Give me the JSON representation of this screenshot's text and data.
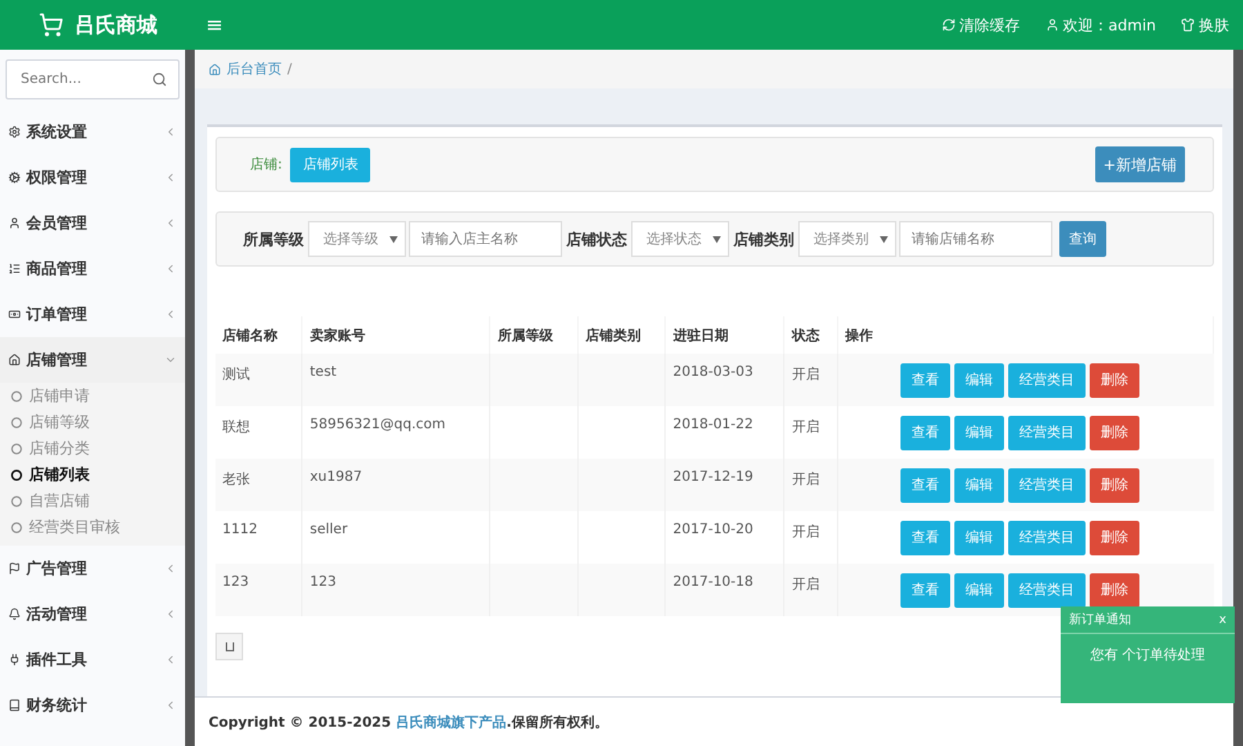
{
  "header": {
    "brand": "吕氏商城",
    "menu_toggle": "≡",
    "actions": [
      {
        "kind": "refresh",
        "label": "清除缓存"
      },
      {
        "kind": "user",
        "label": "欢迎：admin"
      },
      {
        "kind": "skin",
        "label": "换肤"
      }
    ]
  },
  "sidebar": {
    "search": {
      "placeholder": "Search..."
    },
    "items": [
      {
        "kind": "gear",
        "label": "系统设置",
        "expanded": false
      },
      {
        "kind": "gears",
        "label": "权限管理",
        "expanded": false
      },
      {
        "kind": "user",
        "label": "会员管理",
        "expanded": false
      },
      {
        "kind": "list",
        "label": "商品管理",
        "expanded": false
      },
      {
        "kind": "money",
        "label": "订单管理",
        "expanded": false
      },
      {
        "kind": "home",
        "label": "店铺管理",
        "expanded": true,
        "children": [
          {
            "label": "店铺申请",
            "selected": false
          },
          {
            "label": "店铺等级",
            "selected": false
          },
          {
            "label": "店铺分类",
            "selected": false
          },
          {
            "label": "店铺列表",
            "selected": true
          },
          {
            "label": "自营店铺",
            "selected": false
          },
          {
            "label": "经营类目审核",
            "selected": false
          }
        ]
      },
      {
        "kind": "flag",
        "label": "广告管理",
        "expanded": false
      },
      {
        "kind": "bell",
        "label": "活动管理",
        "expanded": false
      },
      {
        "kind": "plug",
        "label": "插件工具",
        "expanded": false
      },
      {
        "kind": "book",
        "label": "财务统计",
        "expanded": false
      }
    ]
  },
  "breadcrumb": {
    "home": "后台首页",
    "separator": "/"
  },
  "toolbar": {
    "label": "店铺:",
    "tab": "店铺列表",
    "add_button": "+新增店铺"
  },
  "filters": [
    {
      "kind": "label",
      "text": "所属等级"
    },
    {
      "kind": "select",
      "text": "选择等级"
    },
    {
      "kind": "input",
      "placeholder": "请输入店主名称"
    },
    {
      "kind": "label",
      "text": "店铺状态"
    },
    {
      "kind": "select",
      "text": "选择状态"
    },
    {
      "kind": "label",
      "text": "店铺类别"
    },
    {
      "kind": "select",
      "text": "选择类别"
    },
    {
      "kind": "input",
      "placeholder": "请输店铺名称"
    },
    {
      "kind": "button",
      "text": "查询"
    }
  ],
  "table": {
    "columns": [
      "店铺名称",
      "卖家账号",
      "所属等级",
      "店铺类别",
      "进驻日期",
      "状态",
      "操作"
    ],
    "rows": [
      {
        "name": "测试",
        "account": "test",
        "date": "2018-03-03",
        "status": "开启",
        "actions": [
          {
            "kind": "info",
            "label": "查看"
          },
          {
            "kind": "info",
            "label": "编辑"
          },
          {
            "kind": "info",
            "label": "经营类目"
          },
          {
            "kind": "danger",
            "label": "删除"
          }
        ]
      },
      {
        "name": "联想",
        "account": "58956321@qq.com",
        "date": "2018-01-22",
        "status": "开启",
        "actions": [
          {
            "kind": "info",
            "label": "查看"
          },
          {
            "kind": "info",
            "label": "编辑"
          },
          {
            "kind": "info",
            "label": "经营类目"
          },
          {
            "kind": "danger",
            "label": "删除"
          }
        ]
      },
      {
        "name": "老张",
        "account": "xu1987",
        "date": "2017-12-19",
        "status": "开启",
        "actions": [
          {
            "kind": "info",
            "label": "查看"
          },
          {
            "kind": "info",
            "label": "编辑"
          },
          {
            "kind": "info",
            "label": "经营类目"
          },
          {
            "kind": "danger",
            "label": "删除"
          }
        ]
      },
      {
        "name": "1112",
        "account": "seller",
        "date": "2017-10-20",
        "status": "开启",
        "actions": [
          {
            "kind": "info",
            "label": "查看"
          },
          {
            "kind": "info",
            "label": "编辑"
          },
          {
            "kind": "info",
            "label": "经营类目"
          },
          {
            "kind": "danger",
            "label": "删除"
          }
        ]
      },
      {
        "name": "123",
        "account": "123",
        "date": "2017-10-18",
        "status": "开启",
        "actions": [
          {
            "kind": "info",
            "label": "查看"
          },
          {
            "kind": "info",
            "label": "编辑"
          },
          {
            "kind": "info",
            "label": "经营类目"
          },
          {
            "kind": "danger",
            "label": "删除"
          }
        ]
      }
    ]
  },
  "footer": {
    "prefix": "Copyright © 2015-2025 ",
    "link": "吕氏商城旗下产品",
    "suffix": ".保留所有权利。"
  },
  "notification": {
    "title": "新订单通知",
    "close": "x",
    "message": "您有 个订单待处理"
  }
}
